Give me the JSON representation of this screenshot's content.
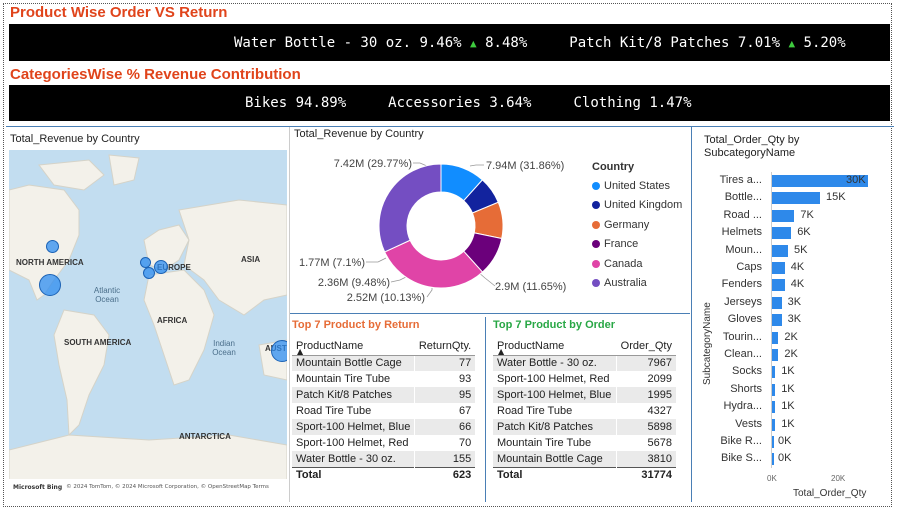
{
  "header1": {
    "title": "Product Wise Order VS Return",
    "ticker": [
      {
        "name": "Water Bottle - 30 oz.",
        "order_pct": "9.46%",
        "return_pct": "8.48%"
      },
      {
        "name": "Patch Kit/8 Patches",
        "order_pct": "7.01%",
        "return_pct": "5.20%"
      }
    ]
  },
  "header2": {
    "title": "CategoriesWise % Revenue Contribution",
    "ticker": [
      {
        "name": "Bikes",
        "pct": "94.89%"
      },
      {
        "name": "Accessories",
        "pct": "3.64%"
      },
      {
        "name": "Clothing",
        "pct": "1.47%"
      }
    ]
  },
  "map_panel": {
    "title": "Total_Revenue by Country",
    "labels": {
      "north_america": "NORTH AMERICA",
      "europe": "EUROPE",
      "asia": "ASIA",
      "africa": "AFRICA",
      "south_america": "SOUTH AMERICA",
      "antarctica": "ANTARCTICA",
      "atlantic": "Atlantic Ocean",
      "indian": "Indian Ocean",
      "aus": "AUST"
    },
    "attribution": "© 2024 TomTom, © 2024 Microsoft Corporation, © OpenStreetMap  Terms",
    "bing": "Microsoft Bing"
  },
  "donut_panel": {
    "title": "Total_Revenue by Country",
    "legend_title": "Country"
  },
  "chart_data": [
    {
      "type": "pie",
      "title": "Total_Revenue by Country",
      "legend_title": "Country",
      "categories": [
        "United States",
        "United Kingdom",
        "Germany",
        "France",
        "Canada",
        "Australia"
      ],
      "values": [
        2.9,
        1.77,
        2.36,
        2.52,
        7.42,
        7.94
      ],
      "data_labels": [
        "2.9M (11.65%)",
        "1.77M (7.1%)",
        "2.36M (9.48%)",
        "2.52M (10.13%)",
        "7.42M (29.77%)",
        "7.94M (31.86%)"
      ],
      "colors": [
        "#118dff",
        "#12239e",
        "#e66c37",
        "#6b007b",
        "#e044a7",
        "#744ec2"
      ]
    },
    {
      "type": "bar",
      "title": "Total_Order_Qty by SubcategoryName",
      "ylabel": "SubcategoryName",
      "xlabel": "Total_Order_Qty",
      "categories": [
        "Tires a...",
        "Bottle...",
        "Road ...",
        "Helmets",
        "Moun...",
        "Caps",
        "Fenders",
        "Jerseys",
        "Gloves",
        "Tourin...",
        "Clean...",
        "Socks",
        "Shorts",
        "Hydra...",
        "Vests",
        "Bike R...",
        "Bike S..."
      ],
      "values": [
        30000,
        15000,
        7000,
        6000,
        5000,
        4000,
        4000,
        3000,
        3000,
        2000,
        2000,
        1000,
        1000,
        1000,
        1000,
        0,
        0
      ],
      "value_labels": [
        "30K",
        "15K",
        "7K",
        "6K",
        "5K",
        "4K",
        "4K",
        "3K",
        "3K",
        "2K",
        "2K",
        "1K",
        "1K",
        "1K",
        "1K",
        "0K",
        "0K"
      ],
      "xticks": [
        "0K",
        "20K"
      ],
      "xlim": [
        0,
        30000
      ],
      "color": "#2e89ea"
    }
  ],
  "return_table": {
    "title": "Top 7 Product by Return",
    "col1": "ProductName",
    "col2": "ReturnQty.",
    "rows": [
      {
        "name": "Mountain Bottle Cage",
        "qty": "77"
      },
      {
        "name": "Mountain Tire Tube",
        "qty": "93"
      },
      {
        "name": "Patch Kit/8 Patches",
        "qty": "95"
      },
      {
        "name": "Road Tire Tube",
        "qty": "67"
      },
      {
        "name": "Sport-100 Helmet, Blue",
        "qty": "66"
      },
      {
        "name": "Sport-100 Helmet, Red",
        "qty": "70"
      },
      {
        "name": "Water Bottle - 30 oz.",
        "qty": "155"
      }
    ],
    "total_label": "Total",
    "total": "623"
  },
  "order_table": {
    "title": "Top 7 Product by Order",
    "col1": "ProductName",
    "col2": "Order_Qty",
    "rows": [
      {
        "name": "Water Bottle - 30 oz.",
        "qty": "7967"
      },
      {
        "name": "Sport-100 Helmet, Red",
        "qty": "2099"
      },
      {
        "name": "Sport-100 Helmet, Blue",
        "qty": "1995"
      },
      {
        "name": "Road Tire Tube",
        "qty": "4327"
      },
      {
        "name": "Patch Kit/8 Patches",
        "qty": "5898"
      },
      {
        "name": "Mountain Tire Tube",
        "qty": "5678"
      },
      {
        "name": "Mountain Bottle Cage",
        "qty": "3810"
      }
    ],
    "total_label": "Total",
    "total": "31774"
  },
  "colors": {
    "title_orange": "#e0441b",
    "order_green": "#28a745",
    "return_orange": "#e66c37",
    "panel_border": "#4a7fb5"
  }
}
